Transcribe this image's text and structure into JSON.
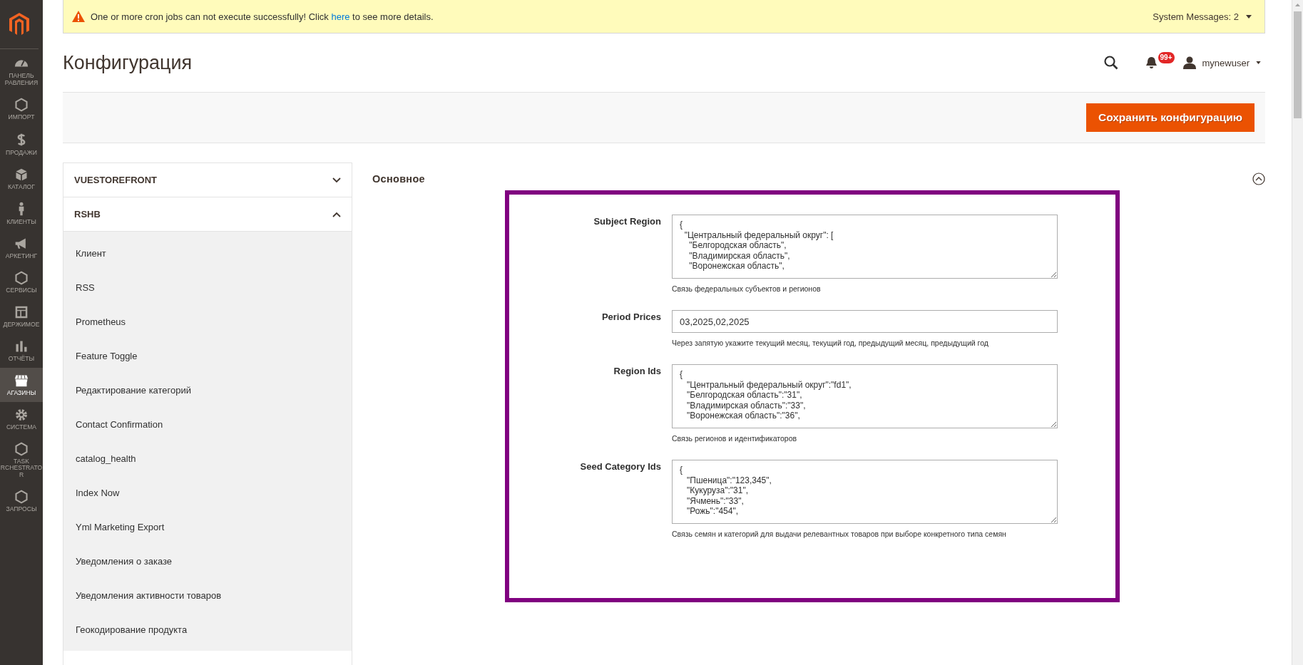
{
  "sidebar": {
    "items": [
      {
        "label": "ПАНЕЛЬ РАВЛЕНИЯ",
        "selected": false
      },
      {
        "label": "ИМПОРТ",
        "selected": false
      },
      {
        "label": "ПРОДАЖИ",
        "selected": false
      },
      {
        "label": "КАТАЛОГ",
        "selected": false
      },
      {
        "label": "КЛИЕНТЫ",
        "selected": false
      },
      {
        "label": "АРКЕТИНГ",
        "selected": false
      },
      {
        "label": "СЕРВИСЫ",
        "selected": false
      },
      {
        "label": "ДЕРЖИМОЕ",
        "selected": false
      },
      {
        "label": "ОТЧЁТЫ",
        "selected": false
      },
      {
        "label": "АГАЗИНЫ",
        "selected": true
      },
      {
        "label": "СИСТЕМА",
        "selected": false
      },
      {
        "label": "TASK RCHESTRATO R",
        "selected": false
      },
      {
        "label": "ЗАПРОСЫ",
        "selected": false
      }
    ]
  },
  "notice": {
    "text_before": "One or more cron jobs can not execute successfully! Click ",
    "link": "here",
    "text_after": " to see more details.",
    "system_messages": "System Messages: 2"
  },
  "header": {
    "title": "Конфигурация",
    "notifications_badge": "99+",
    "user": "mynewuser"
  },
  "actions": {
    "save_button": "Сохранить конфигурацию"
  },
  "config_nav": {
    "groups": [
      {
        "title": "VUESTOREFRONT",
        "expanded": false
      },
      {
        "title": "RSHB",
        "expanded": true,
        "items": [
          "Клиент",
          "RSS",
          "Prometheus",
          "Feature Toggle",
          "Редактирование категорий",
          "Contact Confirmation",
          "catalog_health",
          "Index Now",
          "Yml Marketing Export",
          "Уведомления о заказе",
          "Уведомления активности товаров",
          "Геокодирование продукта"
        ]
      }
    ]
  },
  "section": {
    "title": "Основное",
    "expanded": true,
    "fields": [
      {
        "kind": "textarea",
        "label": "Subject Region",
        "value": "{\n  \"Центральный федеральный округ\": [\n    \"Белгородская область\",\n    \"Владимирская область\",\n    \"Воронежская область\",",
        "note": "Связь федеральных субъектов и регионов"
      },
      {
        "kind": "input",
        "label": "Period Prices",
        "value": "03,2025,02,2025",
        "note": "Через запятую укажите текущий месяц, текущий год, предыдущий месяц, предыдущий год"
      },
      {
        "kind": "textarea",
        "label": "Region Ids",
        "value": "{\n   \"Центральный федеральный округ\":\"fd1\",\n   \"Белгородская область\":\"31\",\n   \"Владимирская область\":\"33\",\n   \"Воронежская область\":\"36\",",
        "note": "Связь регионов и идентификаторов"
      },
      {
        "kind": "textarea",
        "label": "Seed Category Ids",
        "value": "{\n   \"Пшеница\":\"123,345\",\n   \"Кукуруза\":\"31\",\n   \"Ячмень\":\"33\",\n   \"Рожь\":\"454\",",
        "note": "Связь семян и категорий для выдачи релевантных товаров при выборе конкретного типа семян"
      }
    ]
  }
}
